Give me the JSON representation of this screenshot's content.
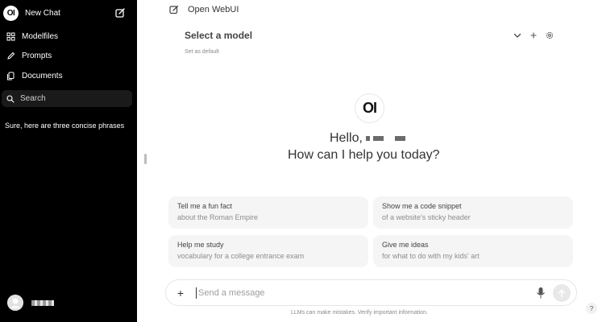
{
  "sidebar": {
    "brand_logo": "OI",
    "new_chat_label": "New Chat",
    "items": [
      {
        "label": "Modelfiles",
        "icon": "modelfiles-icon"
      },
      {
        "label": "Prompts",
        "icon": "pencil-icon"
      },
      {
        "label": "Documents",
        "icon": "document-icon"
      }
    ],
    "search_placeholder": "Search",
    "chats": [
      "Sure, here are three concise phrases"
    ]
  },
  "header": {
    "title": "Open WebUI",
    "model_select": "Select a model",
    "set_default": "Set as default"
  },
  "hero": {
    "logo": "OI",
    "hello": "Hello,",
    "prompt": "How can I help you today?"
  },
  "suggestions": [
    {
      "title": "Tell me a fun fact",
      "subtitle": "about the Roman Empire"
    },
    {
      "title": "Show me a code snippet",
      "subtitle": "of a website's sticky header"
    },
    {
      "title": "Help me study",
      "subtitle": "vocabulary for a college entrance exam"
    },
    {
      "title": "Give me ideas",
      "subtitle": "for what to do with my kids' art"
    }
  ],
  "composer": {
    "placeholder": "Send a message",
    "plus_label": "+"
  },
  "footer": {
    "disclaimer": "LLMs can make mistakes. Verify important information.",
    "help": "?"
  },
  "colors": {
    "sidebar_bg": "#000000",
    "main_bg": "#ffffff",
    "card_bg": "#f5f5f5"
  }
}
